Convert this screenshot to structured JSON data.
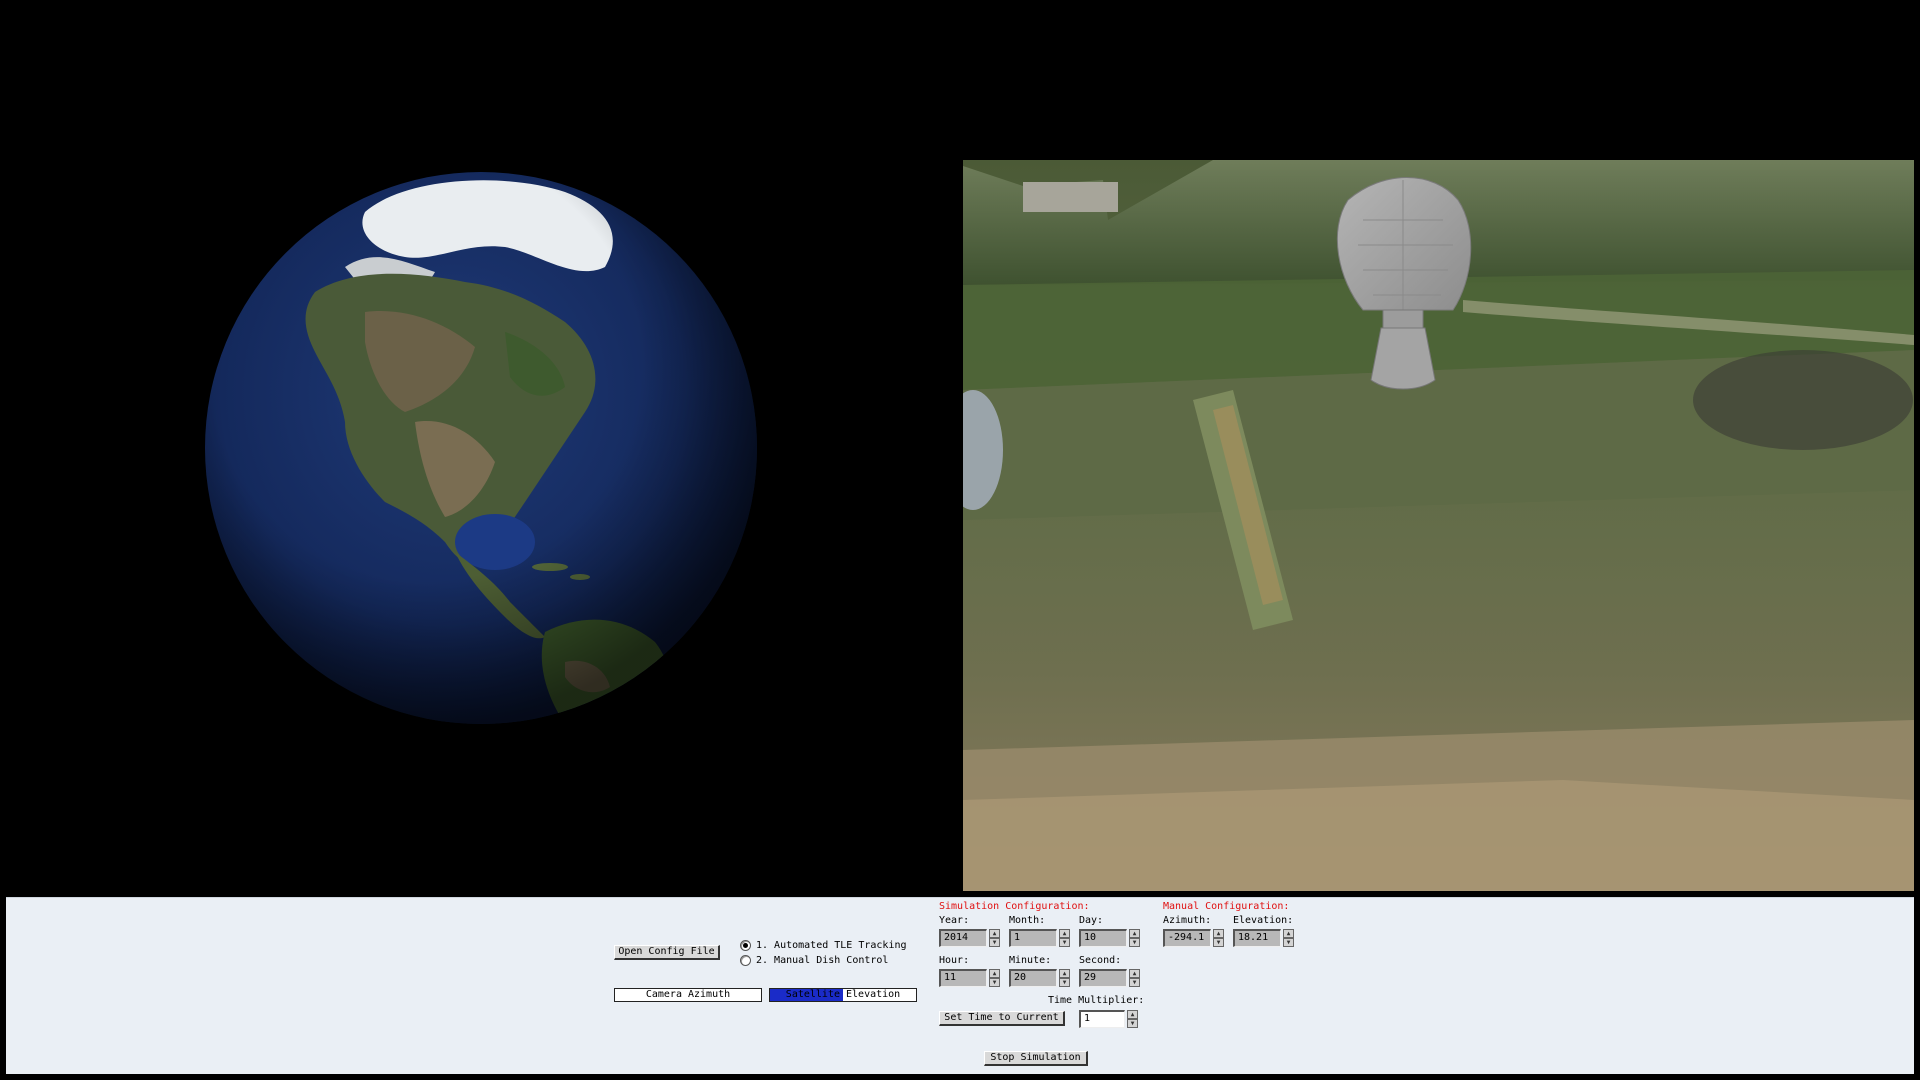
{
  "controls": {
    "open_config_label": "Open Config File",
    "mode_options": [
      {
        "label": "1. Automated TLE Tracking",
        "selected": true
      },
      {
        "label": "2. Manual Dish Control",
        "selected": false
      }
    ],
    "camera_azimuth_label": "Camera Azimuth",
    "satellite_elevation_label": "Satellite Elevation",
    "satellite_elevation_fill": 0.5,
    "set_time_label": "Set Time to Current",
    "stop_simulation_label": "Stop Simulation"
  },
  "simulation": {
    "title": "Simulation Configuration:",
    "year_label": "Year:",
    "year": "2014",
    "month_label": "Month:",
    "month": "1",
    "day_label": "Day:",
    "day": "10",
    "hour_label": "Hour:",
    "hour": "11",
    "minute_label": "Minute:",
    "minute": "20",
    "second_label": "Second:",
    "second": "29",
    "multiplier_label": "Time Multiplier:",
    "multiplier": "1"
  },
  "manual": {
    "title": "Manual Configuration:",
    "azimuth_label": "Azimuth:",
    "azimuth": "-294.1",
    "elevation_label": "Elevation:",
    "elevation": "18.21"
  },
  "colors": {
    "accent_red": "#e01010",
    "elevation_bar": "#1a2bc8",
    "panel_bg": "#eaeff5"
  }
}
